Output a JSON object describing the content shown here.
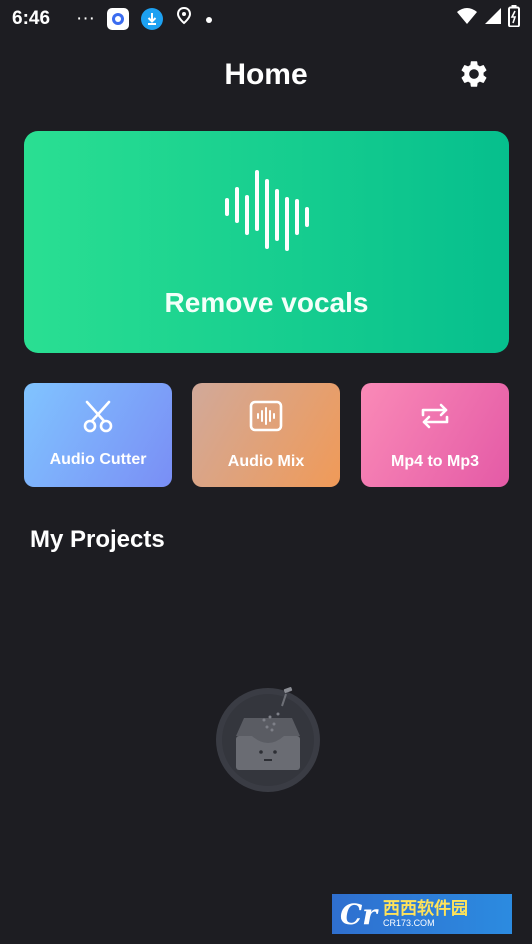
{
  "status_bar": {
    "time": "6:46",
    "dots": "···",
    "icons": [
      "app-icon",
      "download-icon",
      "location-icon",
      "dot-icon",
      "wifi-icon",
      "signal-icon",
      "battery-icon"
    ]
  },
  "header": {
    "title": "Home",
    "settings_icon": "gear-icon"
  },
  "hero": {
    "label": "Remove vocals",
    "icon": "sound-wave-icon",
    "colors": [
      "#2adf92",
      "#06bf8d"
    ]
  },
  "tools": [
    {
      "label": "Audio Cutter",
      "icon": "scissors-icon",
      "colors": [
        "#80c4ff",
        "#7a8ef5"
      ]
    },
    {
      "label": "Audio Mix",
      "icon": "audio-wave-box-icon",
      "colors": [
        "#d1a99a",
        "#f09a58"
      ]
    },
    {
      "label": "Mp4 to Mp3",
      "icon": "repeat-icon",
      "colors": [
        "#fa8ab7",
        "#e45aa6"
      ]
    }
  ],
  "projects": {
    "title": "My Projects",
    "empty_icon": "empty-inbox-icon"
  },
  "watermark": {
    "logo": "Cr",
    "cn": "西西软件园",
    "en": "CR173.COM"
  }
}
